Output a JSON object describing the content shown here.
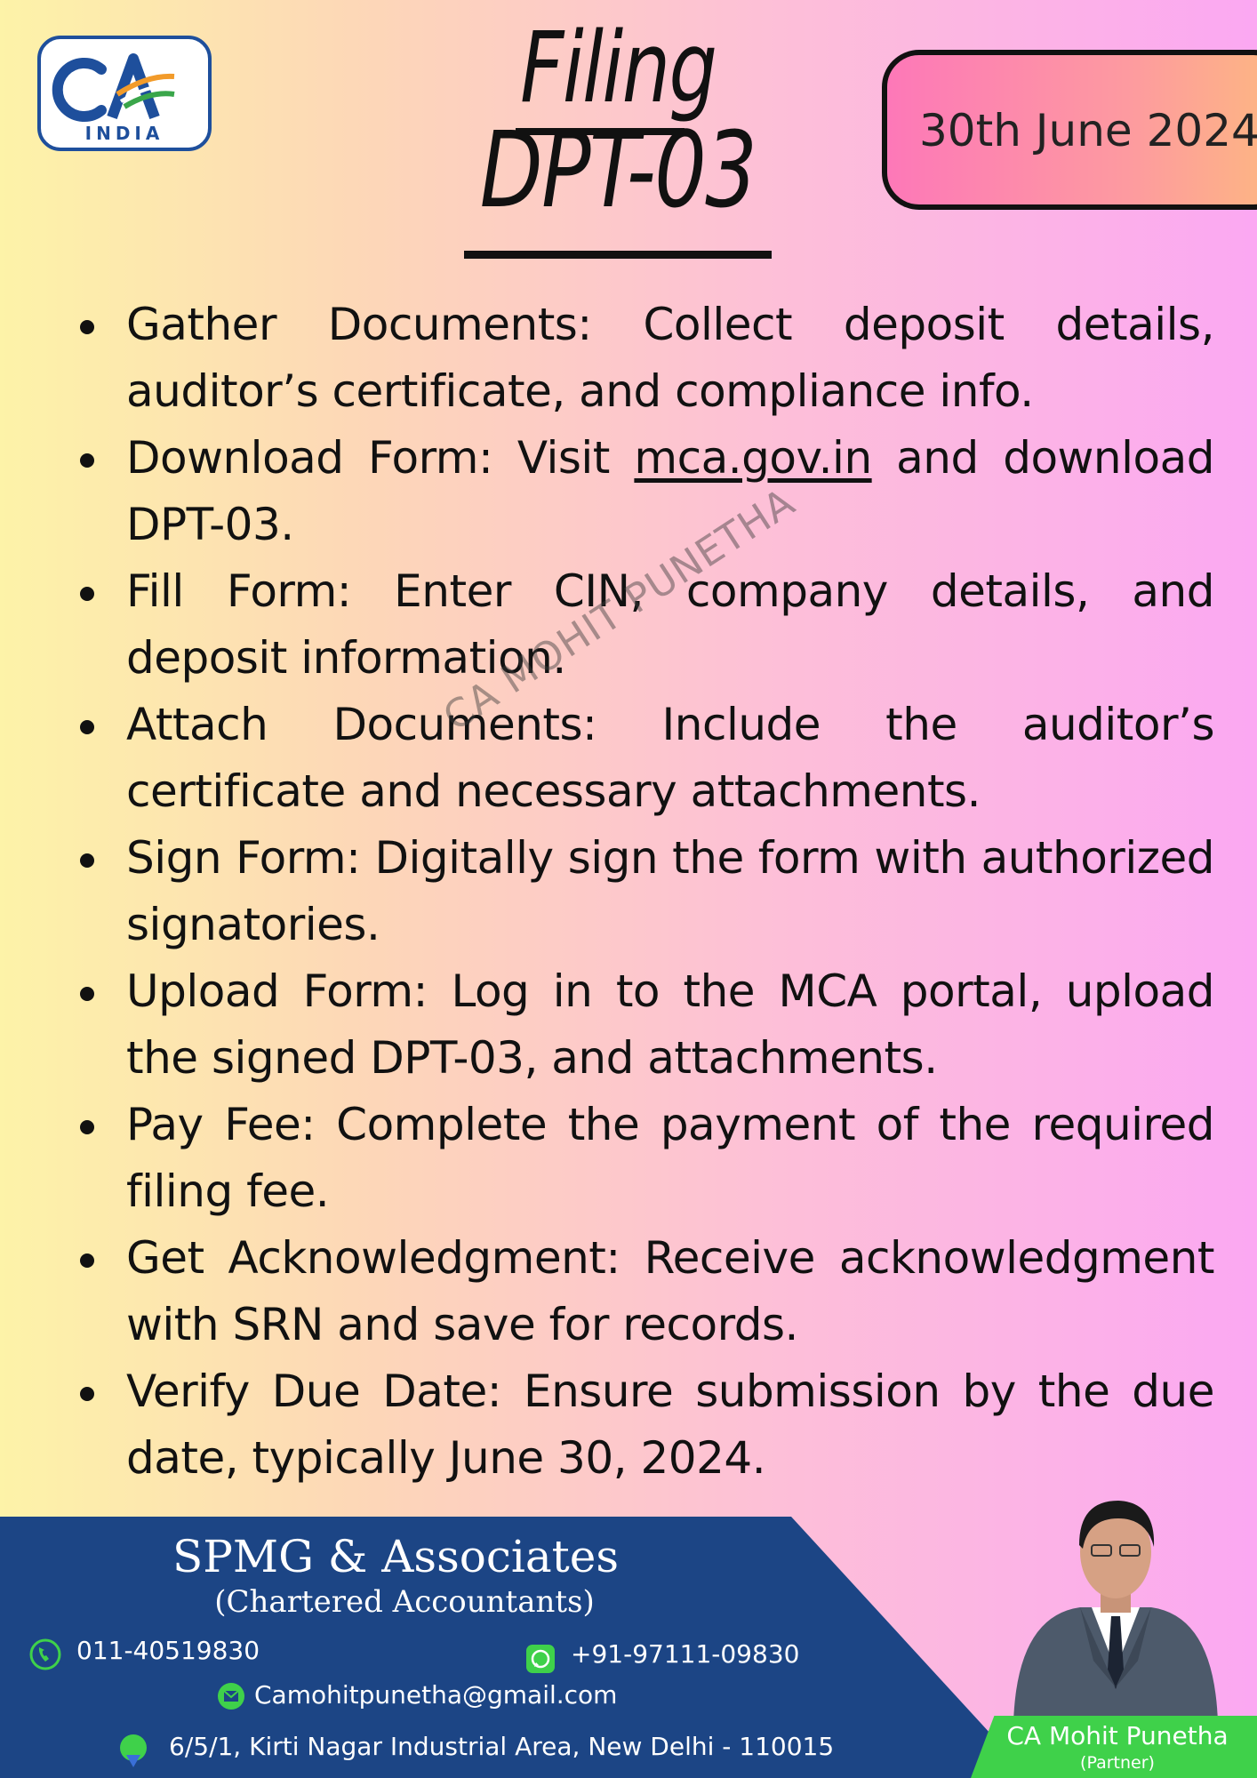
{
  "logo": {
    "text": "INDIA"
  },
  "title": {
    "line1": "Filing",
    "line2": "DPT-03"
  },
  "date_badge": "30th June 2024",
  "steps": [
    {
      "before": "Gather Documents: Collect deposit details, auditor’s certificate, and compliance info.",
      "link": "",
      "after": ""
    },
    {
      "before": "Download Form: Visit ",
      "link": "mca.gov.in",
      "after": " and download DPT-03."
    },
    {
      "before": "Fill Form: Enter CIN, company details, and deposit information.",
      "link": "",
      "after": ""
    },
    {
      "before": "Attach Documents: Include the auditor’s certificate and necessary attachments.",
      "link": "",
      "after": ""
    },
    {
      "before": "Sign Form: Digitally sign the form with authorized signatories.",
      "link": "",
      "after": ""
    },
    {
      "before": "Upload Form: Log in to the MCA portal, upload the signed DPT-03, and attachments.",
      "link": "",
      "after": ""
    },
    {
      "before": "Pay Fee: Complete the payment of the required filing fee.",
      "link": "",
      "after": ""
    },
    {
      "before": "Get Acknowledgment: Receive acknowledgment with SRN and save for records.",
      "link": "",
      "after": ""
    },
    {
      "before": "Verify Due Date: Ensure submission by the due date, typically June 30, 2024.",
      "link": "",
      "after": ""
    }
  ],
  "watermark": "CA MOHIT PUNETHA",
  "footer": {
    "firm_name": "SPMG & Associates",
    "firm_subtitle": "(Chartered Accountants)",
    "phone": "011-40519830",
    "whatsapp": "+91-97111-09830",
    "email": "Camohitpunetha@gmail.com",
    "address": "6/5/1, Kirti Nagar Industrial Area, New Delhi - 110015",
    "person_name": "CA Mohit Punetha",
    "person_role": "(Partner)"
  },
  "colors": {
    "footer_blue": "#1c4585",
    "accent_green": "#3fd14a",
    "logo_blue": "#1e4f9c",
    "badge_pink": "#fd78b8",
    "badge_orange": "#fdb880"
  }
}
